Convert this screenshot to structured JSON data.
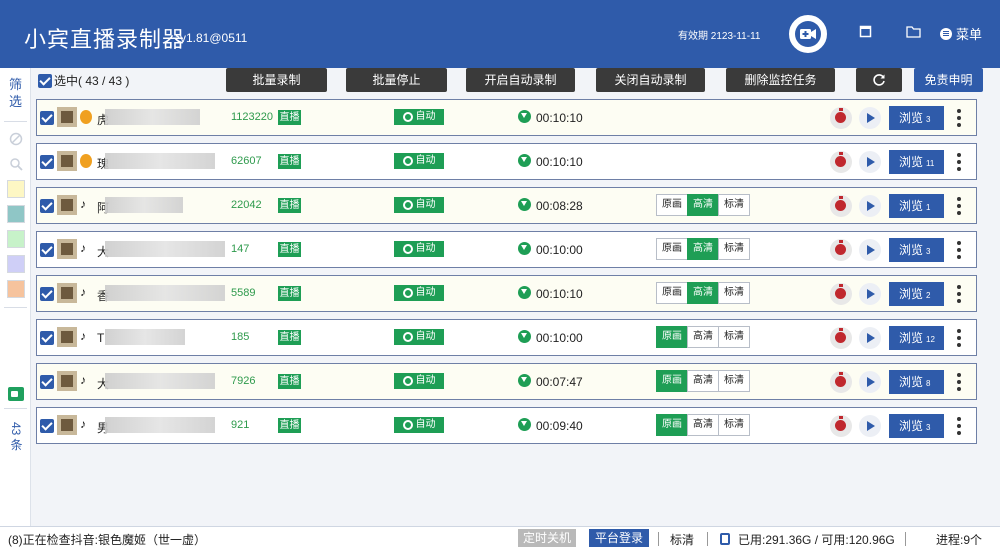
{
  "header": {
    "title": "小宾直播录制器",
    "version": "v1.81@0511",
    "expiry": "有效期 2123-11-11",
    "menu_label": "菜单"
  },
  "sidebar": {
    "filter_label": "筛选",
    "count_label": "43 条",
    "swatch_colors": [
      "#fdf7c4",
      "#8fc6c6",
      "#c7f2c9",
      "#cfcff7",
      "#f6c39d"
    ]
  },
  "toolbar": {
    "select_all_label": "选中( 43  /  43 )",
    "batch_record": "批量录制",
    "batch_stop": "批量停止",
    "enable_auto": "开启自动录制",
    "disable_auto": "关闭自动录制",
    "delete_tasks": "删除监控任务",
    "disclaimer": "免责申明"
  },
  "row_labels": {
    "live": "直播",
    "auto": "自动",
    "browse": "浏览",
    "quality_original": "原画",
    "quality_hd": "高清",
    "quality_sd": "标清"
  },
  "rows": [
    {
      "name": "虎",
      "room_id": "1123220",
      "duration": "00:10:10",
      "browse_count": "3",
      "platform": "huya-icon",
      "quality": null
    },
    {
      "name": "瑰",
      "room_id": "62607",
      "duration": "00:10:10",
      "browse_count": "11",
      "platform": "huya-icon",
      "quality": null
    },
    {
      "name": "阿",
      "room_id": "22042",
      "duration": "00:08:28",
      "browse_count": "1",
      "platform": "douyin-icon",
      "quality": "hd"
    },
    {
      "name": "大",
      "room_id": "147",
      "duration": "00:10:00",
      "browse_count": "3",
      "platform": "douyin-icon",
      "quality": "hd"
    },
    {
      "name": "香",
      "room_id": "5589",
      "duration": "00:10:10",
      "browse_count": "2",
      "platform": "douyin-icon",
      "quality": "hd"
    },
    {
      "name": "T",
      "room_id": "185",
      "duration": "00:10:00",
      "browse_count": "12",
      "platform": "douyin-icon",
      "quality": "original"
    },
    {
      "name": "大",
      "room_id": "7926",
      "duration": "00:07:47",
      "browse_count": "8",
      "platform": "douyin-icon",
      "quality": "original"
    },
    {
      "name": "男",
      "room_id": "921",
      "duration": "00:09:40",
      "browse_count": "3",
      "platform": "douyin-icon",
      "quality": "original"
    }
  ],
  "statusbar": {
    "status_text": "(8)正在检查抖音:银色魔姬（世一虚）",
    "shutdown_label": "定时关机",
    "login_label": "平台登录",
    "quality_label": "标清",
    "disk_label": "已用:291.36G / 可用:120.96G",
    "process_label": "进程:9个"
  }
}
